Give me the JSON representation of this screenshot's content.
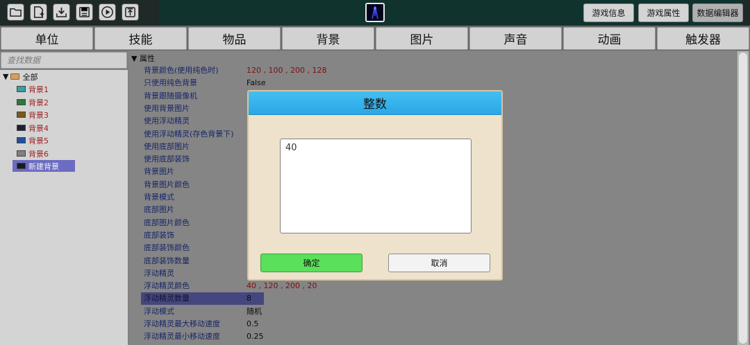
{
  "toolbar": {
    "icons": [
      "folder-icon",
      "new-file-icon",
      "download-icon",
      "save-icon",
      "play-icon",
      "upload-icon"
    ],
    "buttons": [
      {
        "label": "游戏信息"
      },
      {
        "label": "游戏属性"
      },
      {
        "label": "数据编辑器"
      }
    ]
  },
  "tabs": [
    "单位",
    "技能",
    "物品",
    "背景",
    "图片",
    "声音",
    "动画",
    "触发器"
  ],
  "search": {
    "placeholder": "查找数据"
  },
  "tree": {
    "root": "全部",
    "items": [
      {
        "label": "背景1",
        "color": "#3aa0a0"
      },
      {
        "label": "背景2",
        "color": "#2c7a3a"
      },
      {
        "label": "背景3",
        "color": "#7a5a20"
      },
      {
        "label": "背景4",
        "color": "#202030"
      },
      {
        "label": "背景5",
        "color": "#2050a0"
      },
      {
        "label": "背景6",
        "color": "#808080"
      }
    ],
    "selected": "新建背景"
  },
  "props": {
    "header": "属性",
    "rows": [
      {
        "key": "背景颜色(使用纯色时)",
        "value": "120 , 100 , 200 , 128",
        "red": true
      },
      {
        "key": "只使用纯色背景",
        "value": "False"
      },
      {
        "key": "背景跟随摄像机",
        "value": ""
      },
      {
        "key": "使用背景图片",
        "value": ""
      },
      {
        "key": "使用浮动精灵",
        "value": ""
      },
      {
        "key": "使用浮动精灵(存色背景下)",
        "value": ""
      },
      {
        "key": "使用底部图片",
        "value": ""
      },
      {
        "key": "使用底部装饰",
        "value": ""
      },
      {
        "key": "背景图片",
        "value": ""
      },
      {
        "key": "背景图片颜色",
        "value": ""
      },
      {
        "key": "背景模式",
        "value": ""
      },
      {
        "key": "底部图片",
        "value": ""
      },
      {
        "key": "底部图片颜色",
        "value": ""
      },
      {
        "key": "底部装饰",
        "value": ""
      },
      {
        "key": "底部装饰颜色",
        "value": ""
      },
      {
        "key": "底部装饰数量",
        "value": ""
      },
      {
        "key": "浮动精灵",
        "value": ""
      },
      {
        "key": "浮动精灵颜色",
        "value": "40 , 120 , 200 , 20",
        "red": true
      },
      {
        "key": "浮动精灵数量",
        "value": "8",
        "selected": true
      },
      {
        "key": "浮动模式",
        "value": "随机"
      },
      {
        "key": "浮动精灵最大移动速度",
        "value": "0.5"
      },
      {
        "key": "浮动精灵最小移动速度",
        "value": "0.25"
      }
    ]
  },
  "dialog": {
    "title": "整数",
    "value": "40",
    "ok": "确定",
    "cancel": "取消"
  }
}
